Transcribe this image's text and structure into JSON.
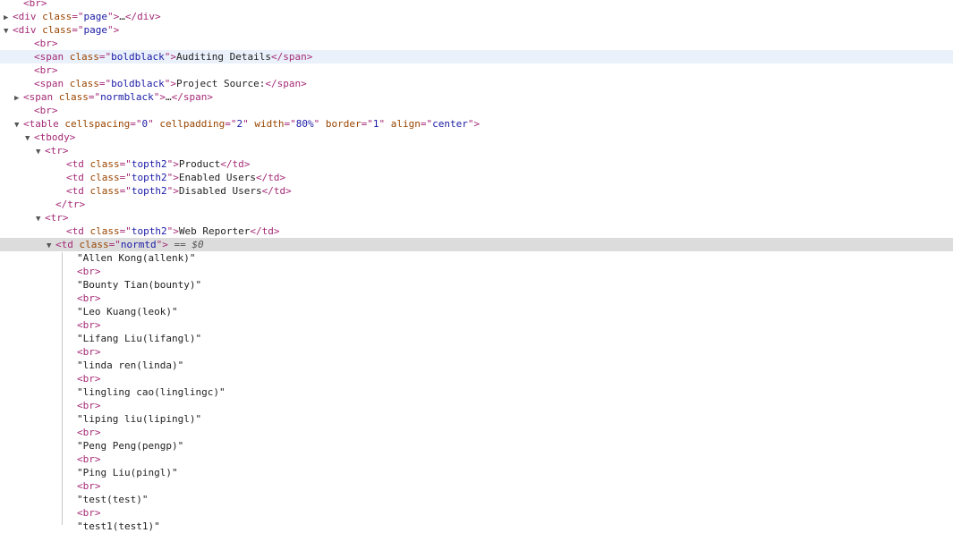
{
  "dom_tree": {
    "rows": [
      {
        "indent": 28,
        "arrow": "",
        "parts": [
          [
            "tag",
            "<br>"
          ]
        ]
      },
      {
        "indent": 16,
        "arrow": "collapsed",
        "parts": [
          [
            "tag",
            "<div "
          ],
          [
            "attr",
            "class"
          ],
          [
            "tag",
            "=\""
          ],
          [
            "val",
            "page"
          ],
          [
            "tag",
            "\">"
          ],
          [
            "txt",
            "…"
          ],
          [
            "tag",
            "</div>"
          ]
        ]
      },
      {
        "indent": 16,
        "arrow": "expanded",
        "parts": [
          [
            "tag",
            "<div "
          ],
          [
            "attr",
            "class"
          ],
          [
            "tag",
            "=\""
          ],
          [
            "val",
            "page"
          ],
          [
            "tag",
            "\">"
          ]
        ]
      },
      {
        "indent": 40,
        "arrow": "",
        "parts": [
          [
            "tag",
            "<br>"
          ]
        ]
      },
      {
        "indent": 40,
        "arrow": "",
        "hl": "light",
        "parts": [
          [
            "tag",
            "<span "
          ],
          [
            "attr",
            "class"
          ],
          [
            "tag",
            "=\""
          ],
          [
            "val",
            "boldblack"
          ],
          [
            "tag",
            "\">"
          ],
          [
            "txt",
            "Auditing Details"
          ],
          [
            "tag",
            "</span>"
          ]
        ]
      },
      {
        "indent": 40,
        "arrow": "",
        "parts": [
          [
            "tag",
            "<br>"
          ]
        ]
      },
      {
        "indent": 40,
        "arrow": "",
        "parts": [
          [
            "tag",
            "<span "
          ],
          [
            "attr",
            "class"
          ],
          [
            "tag",
            "=\""
          ],
          [
            "val",
            "boldblack"
          ],
          [
            "tag",
            "\">"
          ],
          [
            "txt",
            "Project Source:"
          ],
          [
            "tag",
            "</span>"
          ]
        ]
      },
      {
        "indent": 28,
        "arrow": "collapsed",
        "parts": [
          [
            "tag",
            "<span "
          ],
          [
            "attr",
            "class"
          ],
          [
            "tag",
            "=\""
          ],
          [
            "val",
            "normblack"
          ],
          [
            "tag",
            "\">"
          ],
          [
            "txt",
            "…"
          ],
          [
            "tag",
            "</span>"
          ]
        ]
      },
      {
        "indent": 40,
        "arrow": "",
        "parts": [
          [
            "tag",
            "<br>"
          ]
        ]
      },
      {
        "indent": 28,
        "arrow": "expanded",
        "parts": [
          [
            "tag",
            "<table "
          ],
          [
            "attr",
            "cellspacing"
          ],
          [
            "tag",
            "=\""
          ],
          [
            "val",
            "0"
          ],
          [
            "tag",
            "\" "
          ],
          [
            "attr",
            "cellpadding"
          ],
          [
            "tag",
            "=\""
          ],
          [
            "val",
            "2"
          ],
          [
            "tag",
            "\" "
          ],
          [
            "attr",
            "width"
          ],
          [
            "tag",
            "=\""
          ],
          [
            "val",
            "80%"
          ],
          [
            "tag",
            "\" "
          ],
          [
            "attr",
            "border"
          ],
          [
            "tag",
            "=\""
          ],
          [
            "val",
            "1"
          ],
          [
            "tag",
            "\" "
          ],
          [
            "attr",
            "align"
          ],
          [
            "tag",
            "=\""
          ],
          [
            "val",
            "center"
          ],
          [
            "tag",
            "\">"
          ]
        ]
      },
      {
        "indent": 40,
        "arrow": "expanded",
        "parts": [
          [
            "tag",
            "<tbody>"
          ]
        ]
      },
      {
        "indent": 52,
        "arrow": "expanded",
        "parts": [
          [
            "tag",
            "<tr>"
          ]
        ]
      },
      {
        "indent": 76,
        "arrow": "",
        "parts": [
          [
            "tag",
            "<td "
          ],
          [
            "attr",
            "class"
          ],
          [
            "tag",
            "=\""
          ],
          [
            "val",
            "topth2"
          ],
          [
            "tag",
            "\">"
          ],
          [
            "txt",
            "Product"
          ],
          [
            "tag",
            "</td>"
          ]
        ]
      },
      {
        "indent": 76,
        "arrow": "",
        "parts": [
          [
            "tag",
            "<td "
          ],
          [
            "attr",
            "class"
          ],
          [
            "tag",
            "=\""
          ],
          [
            "val",
            "topth2"
          ],
          [
            "tag",
            "\">"
          ],
          [
            "txt",
            "Enabled Users"
          ],
          [
            "tag",
            "</td>"
          ]
        ]
      },
      {
        "indent": 76,
        "arrow": "",
        "parts": [
          [
            "tag",
            "<td "
          ],
          [
            "attr",
            "class"
          ],
          [
            "tag",
            "=\""
          ],
          [
            "val",
            "topth2"
          ],
          [
            "tag",
            "\">"
          ],
          [
            "txt",
            "Disabled Users"
          ],
          [
            "tag",
            "</td>"
          ]
        ]
      },
      {
        "indent": 64,
        "arrow": "",
        "parts": [
          [
            "tag",
            "</tr>"
          ]
        ]
      },
      {
        "indent": 52,
        "arrow": "expanded",
        "parts": [
          [
            "tag",
            "<tr>"
          ]
        ]
      },
      {
        "indent": 76,
        "arrow": "",
        "parts": [
          [
            "tag",
            "<td "
          ],
          [
            "attr",
            "class"
          ],
          [
            "tag",
            "=\""
          ],
          [
            "val",
            "topth2"
          ],
          [
            "tag",
            "\">"
          ],
          [
            "txt",
            "Web Reporter"
          ],
          [
            "tag",
            "</td>"
          ]
        ]
      },
      {
        "indent": 64,
        "arrow": "expanded",
        "hl": "grey",
        "parts": [
          [
            "tag",
            "<td "
          ],
          [
            "attr",
            "class"
          ],
          [
            "tag",
            "=\""
          ],
          [
            "val",
            "normtd"
          ],
          [
            "tag",
            "\">"
          ],
          [
            "muted",
            " == $0"
          ]
        ]
      },
      {
        "indent": 88,
        "arrow": "",
        "parts": [
          [
            "txt",
            "\"Allen Kong(allenk)\""
          ]
        ]
      },
      {
        "indent": 88,
        "arrow": "",
        "parts": [
          [
            "tag",
            "<br>"
          ]
        ]
      },
      {
        "indent": 88,
        "arrow": "",
        "parts": [
          [
            "txt",
            "\"Bounty Tian(bounty)\""
          ]
        ]
      },
      {
        "indent": 88,
        "arrow": "",
        "parts": [
          [
            "tag",
            "<br>"
          ]
        ]
      },
      {
        "indent": 88,
        "arrow": "",
        "parts": [
          [
            "txt",
            "\"Leo Kuang(leok)\""
          ]
        ]
      },
      {
        "indent": 88,
        "arrow": "",
        "parts": [
          [
            "tag",
            "<br>"
          ]
        ]
      },
      {
        "indent": 88,
        "arrow": "",
        "parts": [
          [
            "txt",
            "\"Lifang Liu(lifangl)\""
          ]
        ]
      },
      {
        "indent": 88,
        "arrow": "",
        "parts": [
          [
            "tag",
            "<br>"
          ]
        ]
      },
      {
        "indent": 88,
        "arrow": "",
        "parts": [
          [
            "txt",
            "\"linda ren(linda)\""
          ]
        ]
      },
      {
        "indent": 88,
        "arrow": "",
        "parts": [
          [
            "tag",
            "<br>"
          ]
        ]
      },
      {
        "indent": 88,
        "arrow": "",
        "parts": [
          [
            "txt",
            "\"lingling cao(linglingc)\""
          ]
        ]
      },
      {
        "indent": 88,
        "arrow": "",
        "parts": [
          [
            "tag",
            "<br>"
          ]
        ]
      },
      {
        "indent": 88,
        "arrow": "",
        "parts": [
          [
            "txt",
            "\"liping liu(lipingl)\""
          ]
        ]
      },
      {
        "indent": 88,
        "arrow": "",
        "parts": [
          [
            "tag",
            "<br>"
          ]
        ]
      },
      {
        "indent": 88,
        "arrow": "",
        "parts": [
          [
            "txt",
            "\"Peng Peng(pengp)\""
          ]
        ]
      },
      {
        "indent": 88,
        "arrow": "",
        "parts": [
          [
            "tag",
            "<br>"
          ]
        ]
      },
      {
        "indent": 88,
        "arrow": "",
        "parts": [
          [
            "txt",
            "\"Ping Liu(pingl)\""
          ]
        ]
      },
      {
        "indent": 88,
        "arrow": "",
        "parts": [
          [
            "tag",
            "<br>"
          ]
        ]
      },
      {
        "indent": 88,
        "arrow": "",
        "parts": [
          [
            "txt",
            "\"test(test)\""
          ]
        ]
      },
      {
        "indent": 88,
        "arrow": "",
        "parts": [
          [
            "tag",
            "<br>"
          ]
        ]
      },
      {
        "indent": 88,
        "arrow": "",
        "parts": [
          [
            "txt",
            "\"test1(test1)\""
          ]
        ]
      }
    ]
  },
  "colors": {
    "tag": "#a52a76",
    "attr": "#994500",
    "value": "#1a1aa6",
    "text": "#222222",
    "selected_row": "#dcdcdc",
    "hover_row": "#eaf1fb"
  }
}
